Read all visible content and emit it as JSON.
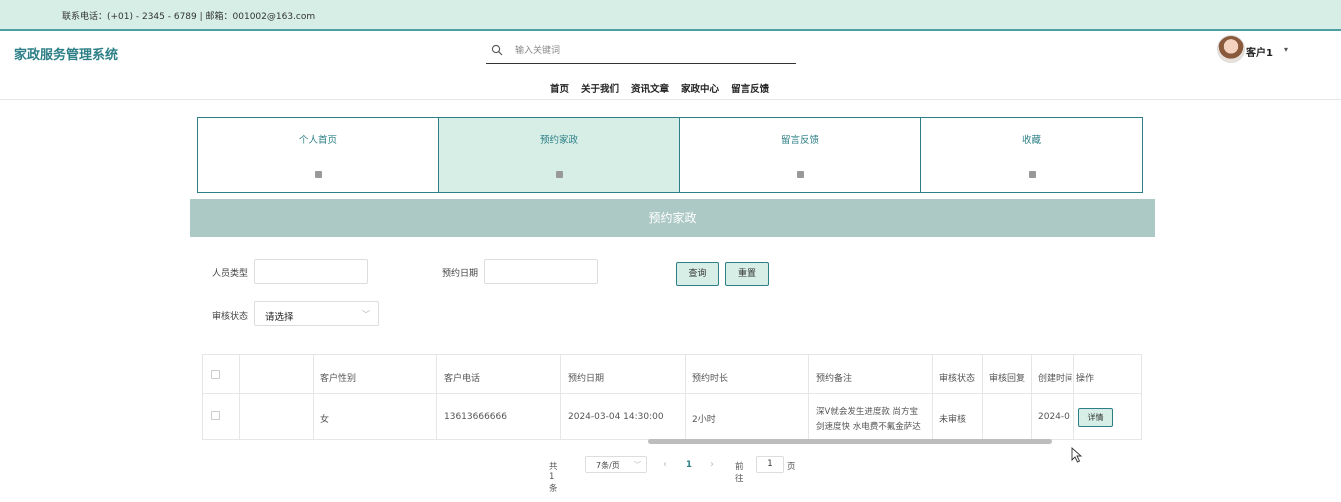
{
  "topbar": {
    "contact": "联系电话：(+01) - 2345 - 6789 | 邮箱：001002@163.com"
  },
  "header": {
    "brand": "家政服务管理系统",
    "search_placeholder": "输入关键词",
    "nav": [
      "首页",
      "关于我们",
      "资讯文章",
      "家政中心",
      "留言反馈"
    ],
    "user_name": "客户1",
    "user_caret": "▾"
  },
  "cards": [
    {
      "label": "个人首页",
      "active": false
    },
    {
      "label": "预约家政",
      "active": true
    },
    {
      "label": "留言反馈",
      "active": false
    },
    {
      "label": "收藏",
      "active": false
    }
  ],
  "banner_title": "预约家政",
  "filters": {
    "staff_type_label": "人员类型",
    "staff_type_value": "",
    "booking_date_label": "预约日期",
    "booking_date_value": "",
    "audit_status_label": "审核状态",
    "audit_status_value": "请选择",
    "query_button": "查询",
    "reset_button": "重置"
  },
  "table": {
    "columns": [
      "",
      "",
      "客户性别",
      "客户电话",
      "预约日期",
      "预约时长",
      "预约备注",
      "审核状态",
      "审核回复",
      "创建时间",
      "操作"
    ],
    "rows": [
      {
        "gender": "女",
        "phone": "13613666666",
        "date": "2024-03-04 14:30:00",
        "duration": "2小时",
        "remark_line1": "深V就会发生进度款 尚方宝",
        "remark_line2": "剑速度快 水电费不氟金萨达",
        "audit_status": "未审核",
        "audit_reply": "",
        "created": "2024-0",
        "action": "详情"
      }
    ]
  },
  "pagination": {
    "total": "共 1 条",
    "page_size": "7条/页",
    "prev": "‹",
    "current": "1",
    "next": "›",
    "goto_label": "前往",
    "goto_value": "1",
    "page_suffix": "页"
  }
}
